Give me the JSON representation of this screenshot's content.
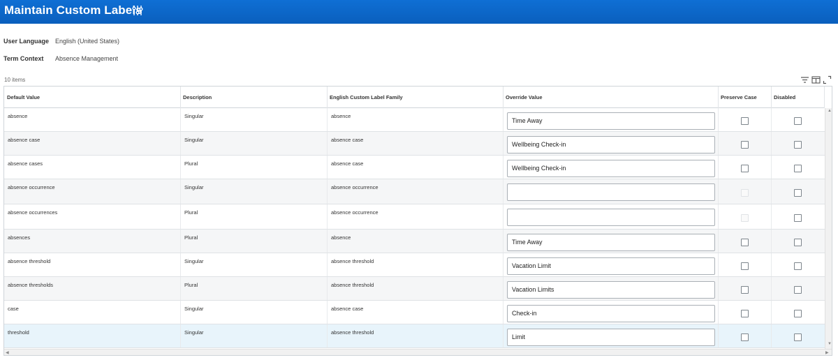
{
  "page": {
    "title": "Maintain Custom Labels",
    "related_actions_icon": "related-actions-icon"
  },
  "filters": {
    "user_language": {
      "label": "User Language",
      "value": "English (United States)"
    },
    "term_context": {
      "label": "Term Context",
      "value": "Absence Management"
    }
  },
  "grid": {
    "count": "10 items",
    "toolbar_icons": [
      "filter-icon",
      "columns-icon",
      "fullscreen-icon"
    ],
    "columns": [
      "Default Value",
      "Description",
      "English Custom Label Family",
      "Override Value",
      "Preserve Case",
      "Disabled"
    ],
    "rows": [
      {
        "default": "absence",
        "description": "Singular",
        "family": "absence",
        "override": "Time Away",
        "preserve_case": false,
        "preserve_enabled": true,
        "disabled": false
      },
      {
        "default": "absence case",
        "description": "Singular",
        "family": "absence case",
        "override": "Wellbeing Check-in",
        "preserve_case": false,
        "preserve_enabled": true,
        "disabled": false
      },
      {
        "default": "absence cases",
        "description": "Plural",
        "family": "absence case",
        "override": "Wellbeing Check-in",
        "preserve_case": false,
        "preserve_enabled": true,
        "disabled": false
      },
      {
        "default": "absence occurrence",
        "description": "Singular",
        "family": "absence occurrence",
        "override": "",
        "preserve_case": false,
        "preserve_enabled": false,
        "disabled": false
      },
      {
        "default": "absence occurrences",
        "description": "Plural",
        "family": "absence occurrence",
        "override": "",
        "preserve_case": false,
        "preserve_enabled": false,
        "disabled": false
      },
      {
        "default": "absences",
        "description": "Plural",
        "family": "absence",
        "override": "Time Away",
        "preserve_case": false,
        "preserve_enabled": true,
        "disabled": false
      },
      {
        "default": "absence threshold",
        "description": "Singular",
        "family": "absence threshold",
        "override": "Vacation Limit",
        "preserve_case": false,
        "preserve_enabled": true,
        "disabled": false
      },
      {
        "default": "absence thresholds",
        "description": "Plural",
        "family": "absence threshold",
        "override": "Vacation Limits",
        "preserve_case": false,
        "preserve_enabled": true,
        "disabled": false
      },
      {
        "default": "case",
        "description": "Singular",
        "family": "absence case",
        "override": "Check-in",
        "preserve_case": false,
        "preserve_enabled": true,
        "disabled": false
      },
      {
        "default": "threshold",
        "description": "Singular",
        "family": "absence threshold",
        "override": "Limit",
        "preserve_case": false,
        "preserve_enabled": true,
        "disabled": false
      }
    ]
  }
}
